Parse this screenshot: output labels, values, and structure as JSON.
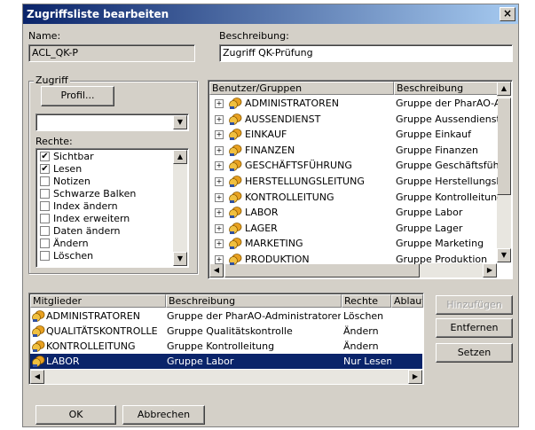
{
  "window": {
    "title": "Zugriffsliste bearbeiten"
  },
  "name": {
    "label": "Name:",
    "value": "ACL_QK-P"
  },
  "beschreibung": {
    "label": "Beschreibung:",
    "value": "Zugriff QK-Prüfung"
  },
  "zugriff": {
    "legend": "Zugriff",
    "profil_button": "Profil...",
    "combo_value": "",
    "rechte_label": "Rechte:",
    "rechte": [
      {
        "label": "Sichtbar",
        "checked": true
      },
      {
        "label": "Lesen",
        "checked": true
      },
      {
        "label": "Notizen",
        "checked": false
      },
      {
        "label": "Schwarze Balken",
        "checked": false
      },
      {
        "label": "Index ändern",
        "checked": false
      },
      {
        "label": "Index erweitern",
        "checked": false
      },
      {
        "label": "Daten ändern",
        "checked": false
      },
      {
        "label": "Ändern",
        "checked": false
      },
      {
        "label": "Löschen",
        "checked": false
      }
    ]
  },
  "benutzer": {
    "headers": [
      "Benutzer/Gruppen",
      "Beschreibung"
    ],
    "rows": [
      {
        "name": "ADMINISTRATOREN",
        "desc": "Gruppe der PharAO-Adı"
      },
      {
        "name": "AUSSENDIENST",
        "desc": "Gruppe Aussendienst"
      },
      {
        "name": "EINKAUF",
        "desc": "Gruppe Einkauf"
      },
      {
        "name": "FINANZEN",
        "desc": "Gruppe Finanzen"
      },
      {
        "name": "GESCHÄFTSFÜHRUNG",
        "desc": "Gruppe Geschäftsführu"
      },
      {
        "name": "HERSTELLUNGSLEITUNG",
        "desc": "Gruppe Herstellungsleit"
      },
      {
        "name": "KONTROLLEITUNG",
        "desc": "Gruppe Kontrolleitung"
      },
      {
        "name": "LABOR",
        "desc": "Gruppe Labor"
      },
      {
        "name": "LAGER",
        "desc": "Gruppe Lager"
      },
      {
        "name": "MARKETING",
        "desc": "Gruppe Marketing"
      },
      {
        "name": "PRODUKTION",
        "desc": "Gruppe Produktion"
      }
    ]
  },
  "mitglieder": {
    "headers": [
      "Mitglieder",
      "Beschreibung",
      "Rechte",
      "Ablauf"
    ],
    "rows": [
      {
        "name": "ADMINISTRATOREN",
        "desc": "Gruppe der PharAO-Administratoren",
        "rechte": "Löschen",
        "selected": false
      },
      {
        "name": "QUALITÄTSKONTROLLE",
        "desc": "Gruppe Qualitätskontrolle",
        "rechte": "Ändern",
        "selected": false
      },
      {
        "name": "KONTROLLEITUNG",
        "desc": "Gruppe Kontrolleitung",
        "rechte": "Ändern",
        "selected": false
      },
      {
        "name": "LABOR",
        "desc": "Gruppe Labor",
        "rechte": "Nur Lesen",
        "selected": true
      }
    ]
  },
  "buttons": {
    "hinzufuegen": "Hinzufügen",
    "entfernen": "Entfernen",
    "setzen": "Setzen",
    "ok": "OK",
    "abbrechen": "Abbrechen"
  }
}
